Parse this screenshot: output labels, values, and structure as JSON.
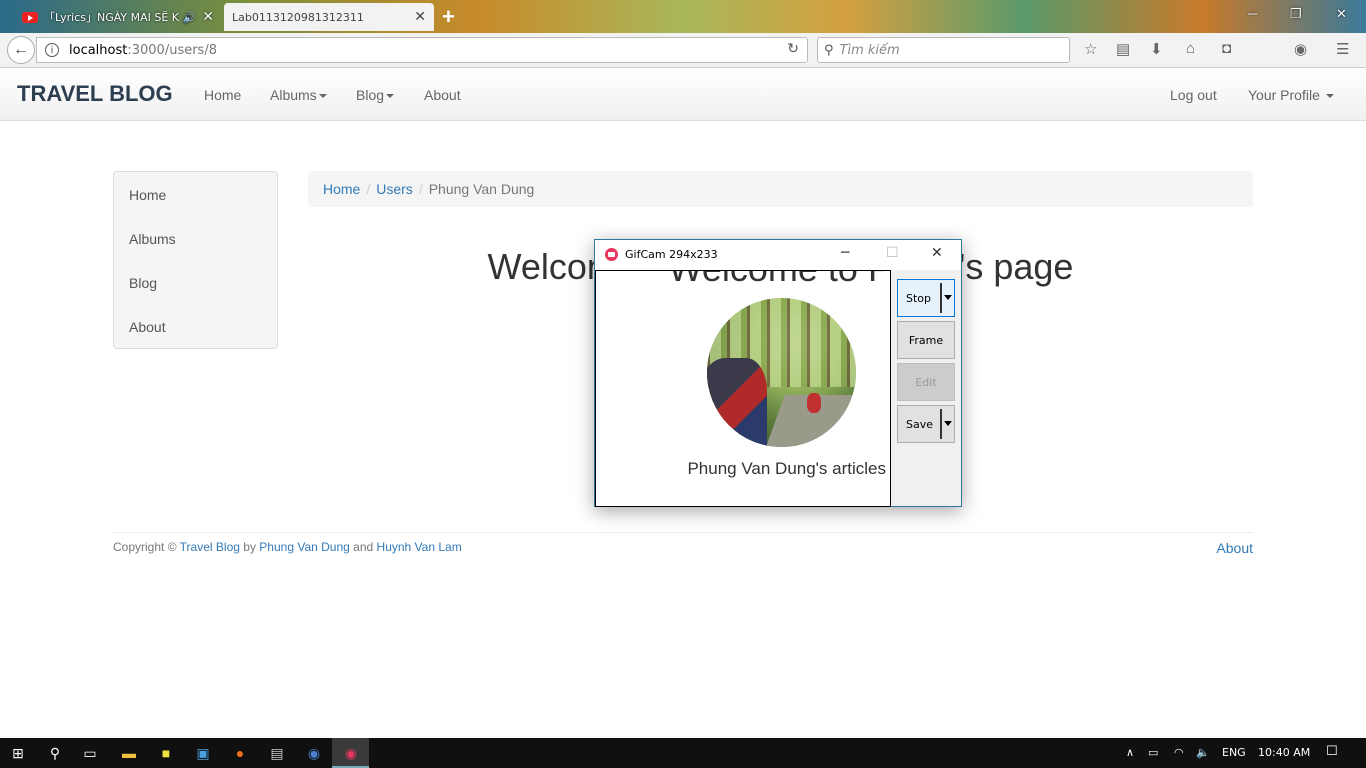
{
  "browser": {
    "tabs": [
      {
        "label": "「Lyrics」NGÀY MAI SẼ KHÁC",
        "active": false,
        "audio": true
      },
      {
        "label": "Lab0113120981312311",
        "active": true
      }
    ],
    "url_host": "localhost",
    "url_path": ":3000/users/8",
    "search_placeholder": "Tìm kiếm"
  },
  "site": {
    "brand": "TRAVEL BLOG",
    "nav": {
      "home": "Home",
      "albums": "Albums",
      "blog": "Blog",
      "about": "About"
    },
    "nav_right": {
      "logout": "Log out",
      "profile": "Your Profile"
    }
  },
  "sidebar": {
    "items": [
      {
        "label": "Home"
      },
      {
        "label": "Albums"
      },
      {
        "label": "Blog"
      },
      {
        "label": "About"
      }
    ]
  },
  "breadcrumb": {
    "items": [
      "Home",
      "Users"
    ],
    "active": "Phung Van Dung"
  },
  "main": {
    "welcome": "Welcome to Phung Van Dung's page",
    "articles": "Phung Van Dung's articles"
  },
  "footer": {
    "copyright": "Copyright ©",
    "site_link": "Travel Blog",
    "by": "by",
    "author1": "Phung Van Dung",
    "and": "and",
    "author2": "Huynh Van Lam",
    "about": "About"
  },
  "gifcam": {
    "title": "GifCam 294x233",
    "buttons": {
      "stop": "Stop",
      "frame": "Frame",
      "edit": "Edit",
      "save": "Save"
    }
  },
  "taskbar": {
    "lang": "ENG",
    "time": "10:40 AM"
  }
}
